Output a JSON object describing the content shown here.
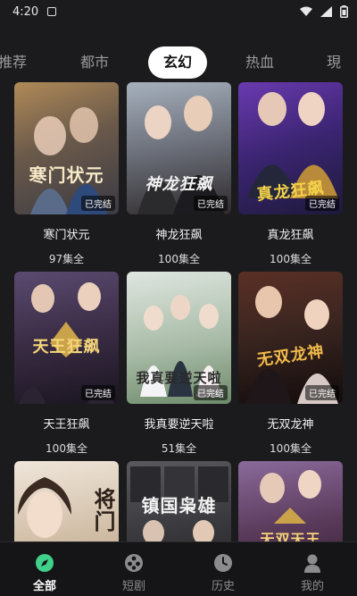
{
  "status_bar": {
    "time": "4:20"
  },
  "tabs": [
    {
      "label": "推荐"
    },
    {
      "label": "都市"
    },
    {
      "label": "玄幻",
      "active": true
    },
    {
      "label": "热血"
    },
    {
      "label": "現"
    }
  ],
  "dramas": [
    {
      "cover_title": "寒门状元",
      "badge": "已完结",
      "title": "寒门状元",
      "episodes": "97集全",
      "bg1": "#b08a58",
      "bg2": "#3a3a44",
      "title_color": "#f6e9c6"
    },
    {
      "cover_title": "神龙狂飙",
      "badge": "已完结",
      "title": "神龙狂飙",
      "episodes": "100集全",
      "bg1": "#8a94a3",
      "bg2": "#2f2a2c",
      "title_color": "#f2f2f2"
    },
    {
      "cover_title": "真龙狂飙",
      "badge": "已完结",
      "title": "真龙狂飙",
      "episodes": "100集全",
      "bg1": "#4b2a8a",
      "bg2": "#1d1a3a",
      "title_color": "#f4d24a"
    },
    {
      "cover_title": "天王狂飙",
      "badge": "已完结",
      "title": "天王狂飙",
      "episodes": "100集全",
      "bg1": "#4a3a5e",
      "bg2": "#1a1520",
      "title_color": "#f5d77a"
    },
    {
      "cover_title": "我真要逆天啦",
      "badge": "已完结",
      "title": "我真要逆天啦",
      "episodes": "51集全",
      "bg1": "#cfd8d2",
      "bg2": "#6e8a6a",
      "title_color": "#2a2a2a"
    },
    {
      "cover_title": "无双龙神",
      "badge": "已完结",
      "title": "无双龙神",
      "episodes": "100集全",
      "bg1": "#3a2520",
      "bg2": "#120c0c",
      "title_color": "#f0b94a"
    },
    {
      "cover_title": "将门",
      "badge": "",
      "title": "",
      "episodes": "",
      "bg1": "#e8ddd0",
      "bg2": "#b79f86",
      "title_color": "#2b1f17"
    },
    {
      "cover_title": "镇国枭雄",
      "badge": "",
      "title": "",
      "episodes": "",
      "bg1": "#4a4a4e",
      "bg2": "#1f1f22",
      "title_color": "#f2f2f2"
    },
    {
      "cover_title": "无双天王",
      "badge": "",
      "title": "",
      "episodes": "",
      "bg1": "#7a5a8a",
      "bg2": "#2a1a28",
      "title_color": "#f5d47a"
    }
  ],
  "bottom_nav": [
    {
      "label": "全部",
      "icon": "compass-icon",
      "active": true
    },
    {
      "label": "短剧",
      "icon": "film-reel-icon"
    },
    {
      "label": "历史",
      "icon": "clock-icon"
    },
    {
      "label": "我的",
      "icon": "person-icon"
    }
  ],
  "colors": {
    "background": "#1b1b1d",
    "active_tab_bg": "#ffffff",
    "nav_active_icon": "#3fd08a"
  }
}
